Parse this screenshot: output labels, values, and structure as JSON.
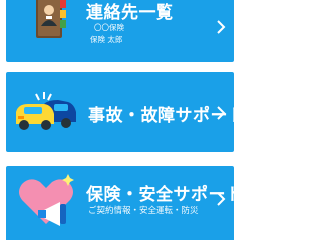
{
  "cards": [
    {
      "title": "連絡先一覧",
      "lines": [
        "〇〇保険",
        "保険 太郎"
      ],
      "icon": "address-book-icon"
    },
    {
      "title": "事故・故障サポート",
      "icon": "car-accident-icon"
    },
    {
      "title": "保険・安全サポート",
      "subtitle": "ご契約情報・安全運転・防災",
      "icon": "heart-megaphone-icon"
    }
  ],
  "colors": {
    "card_bg": "#1aa0e8",
    "text": "#ffffff"
  }
}
